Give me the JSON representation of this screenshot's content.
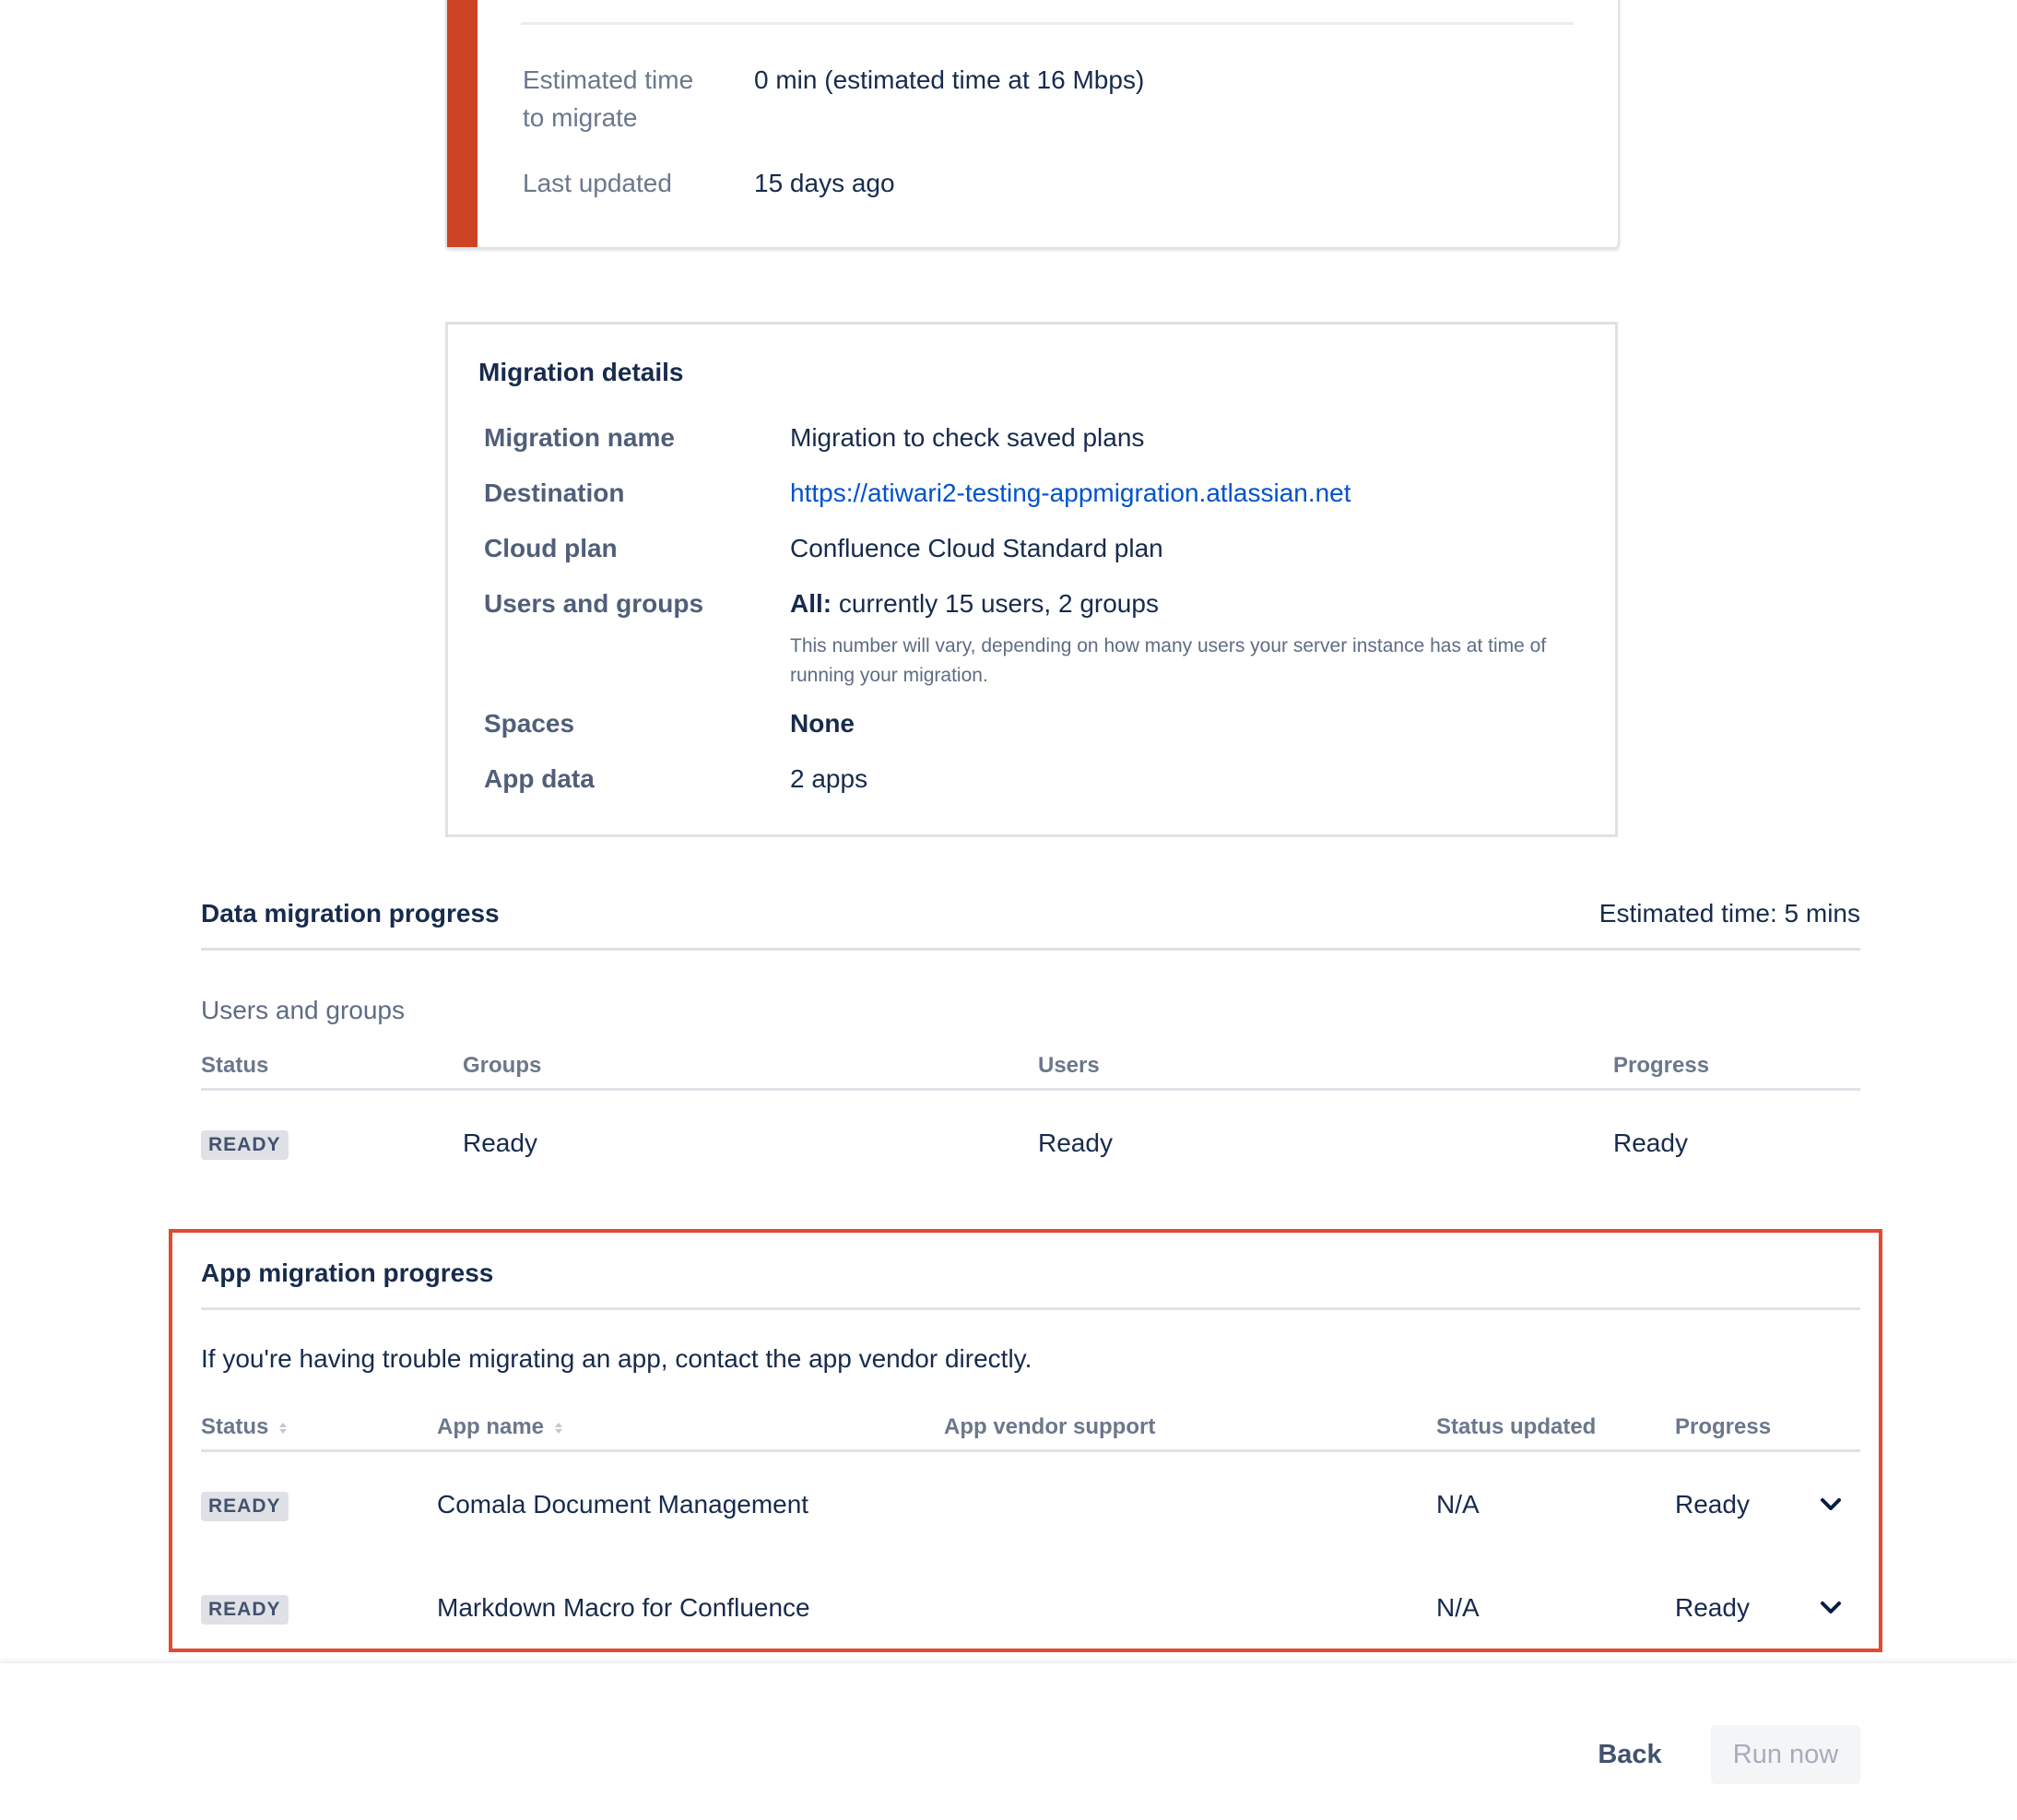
{
  "summary": {
    "estimated_time_label_line1": "Estimated time",
    "estimated_time_label_line2": "to migrate",
    "estimated_time_value": "0 min (estimated time at 16 Mbps)",
    "last_updated_label": "Last updated",
    "last_updated_value": "15 days ago",
    "accent_color": "#cc4424"
  },
  "details": {
    "title": "Migration details",
    "rows": [
      {
        "label": "Migration name",
        "value": "Migration to check saved plans"
      },
      {
        "label": "Destination",
        "value": "https://atiwari2-testing-appmigration.atlassian.net"
      },
      {
        "label": "Cloud plan",
        "value": "Confluence Cloud Standard plan"
      },
      {
        "label": "Users and groups",
        "value_bold": "All:",
        "value": "currently 15 users, 2 groups",
        "note": "This number will vary, depending on how many users your server instance has at time of running your migration."
      },
      {
        "label": "Spaces",
        "value": "None"
      },
      {
        "label": "App data",
        "value": "2 apps"
      }
    ],
    "link_color": "#0052cc"
  },
  "data_progress": {
    "title": "Data migration progress",
    "estimated_time": "Estimated time: 5 mins",
    "subheading": "Users and groups",
    "columns": [
      "Status",
      "Groups",
      "Users",
      "Progress"
    ],
    "row": {
      "status": "READY",
      "groups": "Ready",
      "users": "Ready",
      "progress": "Ready"
    }
  },
  "app_progress": {
    "title": "App migration progress",
    "intro": "If you're having trouble migrating an app, contact the app vendor directly.",
    "columns": [
      "Status",
      "App name",
      "App vendor support",
      "Status updated",
      "Progress"
    ],
    "rows": [
      {
        "status": "READY",
        "app_name": "Comala Document Management",
        "vendor_support": "",
        "status_updated": "N/A",
        "progress": "Ready"
      },
      {
        "status": "READY",
        "app_name": "Markdown Macro for Confluence",
        "vendor_support": "",
        "status_updated": "N/A",
        "progress": "Ready"
      }
    ],
    "highlight_color": "#e04a31"
  },
  "footer": {
    "back_label": "Back",
    "run_label": "Run now"
  }
}
